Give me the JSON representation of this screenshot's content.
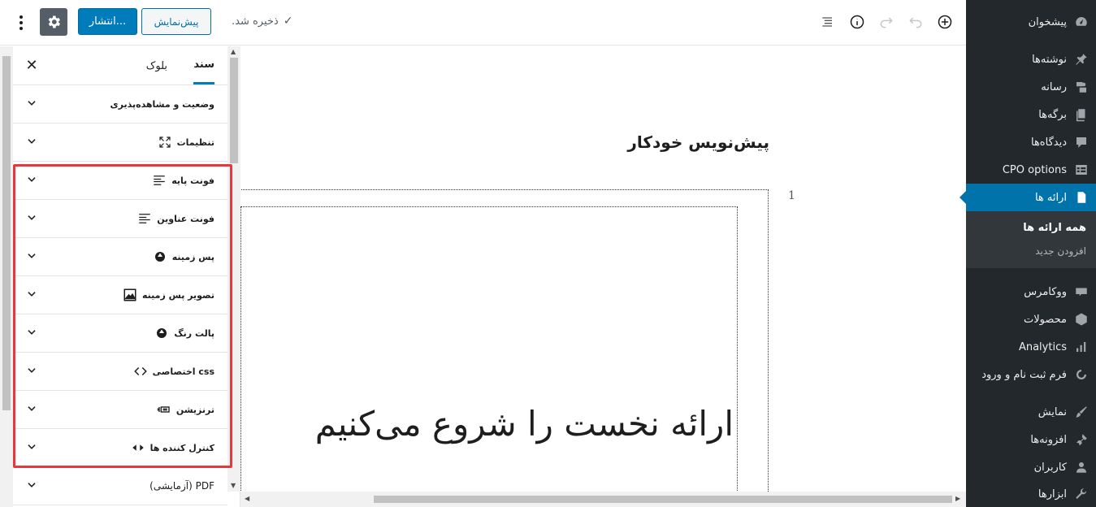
{
  "topbar": {
    "publish_label": "انتشار...",
    "preview_label": "پیش‌نمایش",
    "saved_text": "ذخیره شد.",
    "saved_icon": "check-icon"
  },
  "sidebar": {
    "tabs": [
      {
        "label": "سند",
        "active": true
      },
      {
        "label": "بلوک",
        "active": false
      }
    ],
    "close_label": "✕",
    "rows": [
      {
        "label": "وضعیت و مشاهده‌پذیری",
        "icon": null
      },
      {
        "label": "تنظیمات",
        "icon": "fullscreen-icon"
      },
      {
        "label": "فونت پایه",
        "icon": "text-lines-icon"
      },
      {
        "label": "فونت عناوین",
        "icon": "text-lines-icon"
      },
      {
        "label": "پس زمینه",
        "icon": "color-drop-icon"
      },
      {
        "label": "تصویر پس زمینه",
        "icon": "image-icon"
      },
      {
        "label": "پالت رنگ",
        "icon": "color-drop-icon"
      },
      {
        "label": "css اختصاصی",
        "icon": "code-icon"
      },
      {
        "label": "ترنزیشن",
        "icon": "transition-icon"
      },
      {
        "label": "کنترل کننده ها",
        "icon": "controls-icon"
      },
      {
        "label": "PDF (آزمایشی)",
        "icon": null
      }
    ]
  },
  "canvas": {
    "doc_title": "پیش‌نویس خودکار",
    "page_number": "1",
    "slide_heading": "ارائه نخست را شروع می‌کنیم"
  },
  "admin_menu": {
    "items": [
      {
        "label": "پیشخوان",
        "icon": "dashboard-icon"
      },
      {
        "label": "نوشته‌ها",
        "icon": "pin-icon"
      },
      {
        "label": "رسانه",
        "icon": "media-icon"
      },
      {
        "label": "برگه‌ها",
        "icon": "pages-icon"
      },
      {
        "label": "دیدگاه‌ها",
        "icon": "comments-icon"
      },
      {
        "label": "CPO options",
        "icon": "table-icon"
      },
      {
        "label": "ارائه ها",
        "icon": "document-icon"
      },
      {
        "label": "ووکامرس",
        "icon": "woo-icon"
      },
      {
        "label": "محصولات",
        "icon": "box-icon"
      },
      {
        "label": "Analytics",
        "icon": "bar-chart-icon"
      },
      {
        "label": "فرم ثبت نام و ورود",
        "icon": "circle-icon"
      },
      {
        "label": "نمایش",
        "icon": "brush-icon"
      },
      {
        "label": "افزونه‌ها",
        "icon": "plugin-icon"
      },
      {
        "label": "کاربران",
        "icon": "user-icon"
      },
      {
        "label": "ابزارها",
        "icon": "wrench-icon"
      }
    ],
    "current": "ارائه ها",
    "submenu": [
      {
        "label": "همه ارائه ها",
        "active": true
      },
      {
        "label": "افزودن جدید",
        "active": false
      }
    ]
  },
  "colors": {
    "admin_bg": "#23282d",
    "admin_current": "#0073aa",
    "primary_button": "#007cba",
    "highlight_border": "#e7393c"
  }
}
